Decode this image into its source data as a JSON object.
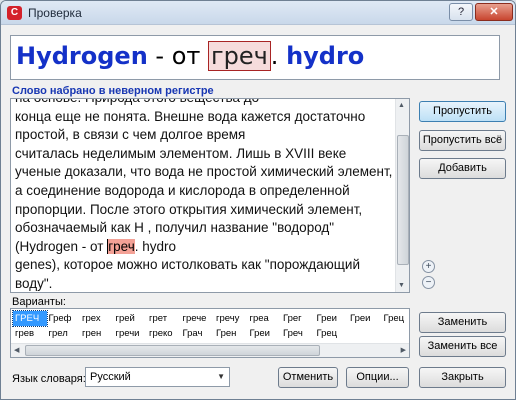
{
  "window": {
    "title": "Проверка",
    "help_label": "?",
    "close_label": "✕"
  },
  "preview": {
    "prefix": "Hydrogen",
    "middle": " - от ",
    "error_word": "греч",
    "after_error": ". ",
    "suffix": "hydro"
  },
  "error_message": "Слово набрано в неверном регистре",
  "text": {
    "before_highlight": "на основе. Природа этого вещества до\nконца еще не понята. Внешне вода кажется достаточно простой, в связи с чем долгое время\nсчиталась неделимым элементом. Лишь в XVIII веке ученые доказали, что вода не простой химический элемент, а соединение водорода и кислорода в определенной пропорции. После этого открытия химический элемент, обозначаемый как Н , получил название \"водород\" (Hydrogen - от ",
    "highlight_start": "г",
    "highlight_rest": "реч",
    "after_highlight": ". hydro\ngenes), которое можно истолковать как \"порождающий воду\"."
  },
  "buttons": {
    "skip": "Пропустить",
    "skip_all": "Пропустить всё",
    "add": "Добавить",
    "replace": "Заменить",
    "replace_all": "Заменить все",
    "close": "Закрыть",
    "cancel": "Отменить",
    "options": "Опции..."
  },
  "zoom": {
    "in_label": "+",
    "out_label": "−"
  },
  "variants": {
    "label": "Варианты:",
    "items": [
      "ГРЕЧ",
      "Греф",
      "грех",
      "грей",
      "грет",
      "грече",
      "гречу",
      "греа",
      "Грег",
      "Греи",
      "Греи",
      "Грец",
      "Греч",
      "грек",
      "грев",
      "грел",
      "грен",
      "гречи",
      "греко",
      "Грач",
      "Грен",
      "Греи",
      "Греч",
      "Грец"
    ],
    "selected_index": 0
  },
  "language": {
    "label": "Язык словаря:",
    "selected": "Русский"
  }
}
